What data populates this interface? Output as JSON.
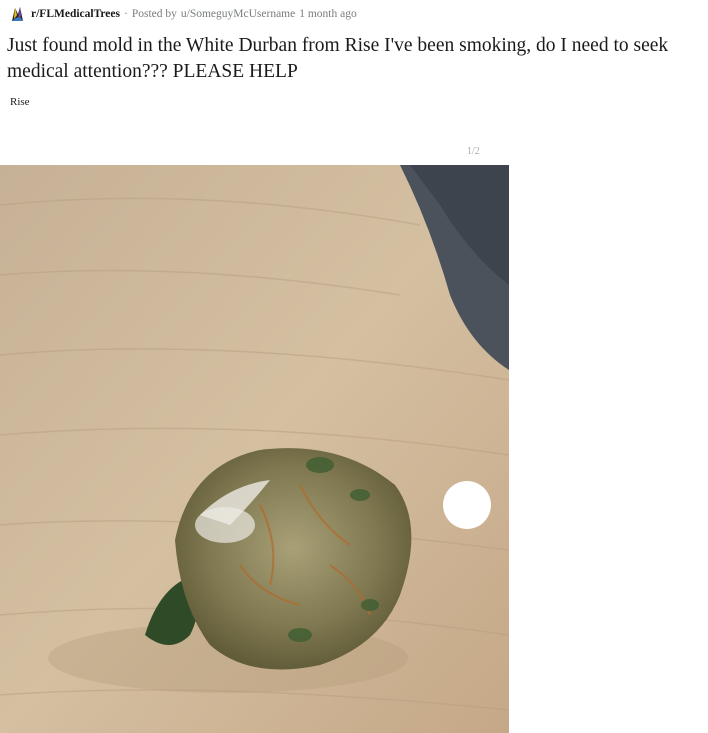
{
  "post": {
    "subreddit": "r/FLMedicalTrees",
    "separator": "·",
    "posted_by": "Posted by",
    "username": "u/SomeguyMcUsername",
    "age": "1 month ago",
    "title": "Just found mold in the White Durban from Rise I've been smoking, do I need to seek medical attention??? PLEASE HELP",
    "flair": "Rise"
  },
  "gallery": {
    "counter": "1/2",
    "image_subject": "cannabis bud with white mold on a wooden table"
  },
  "icons": {
    "subreddit": "subreddit-icon",
    "next": "next-image-button"
  },
  "colors": {
    "meta_text": "#787c7e",
    "title_text": "#1a1a1b",
    "wood": "#c9b396",
    "fabric": "#4b525c"
  }
}
